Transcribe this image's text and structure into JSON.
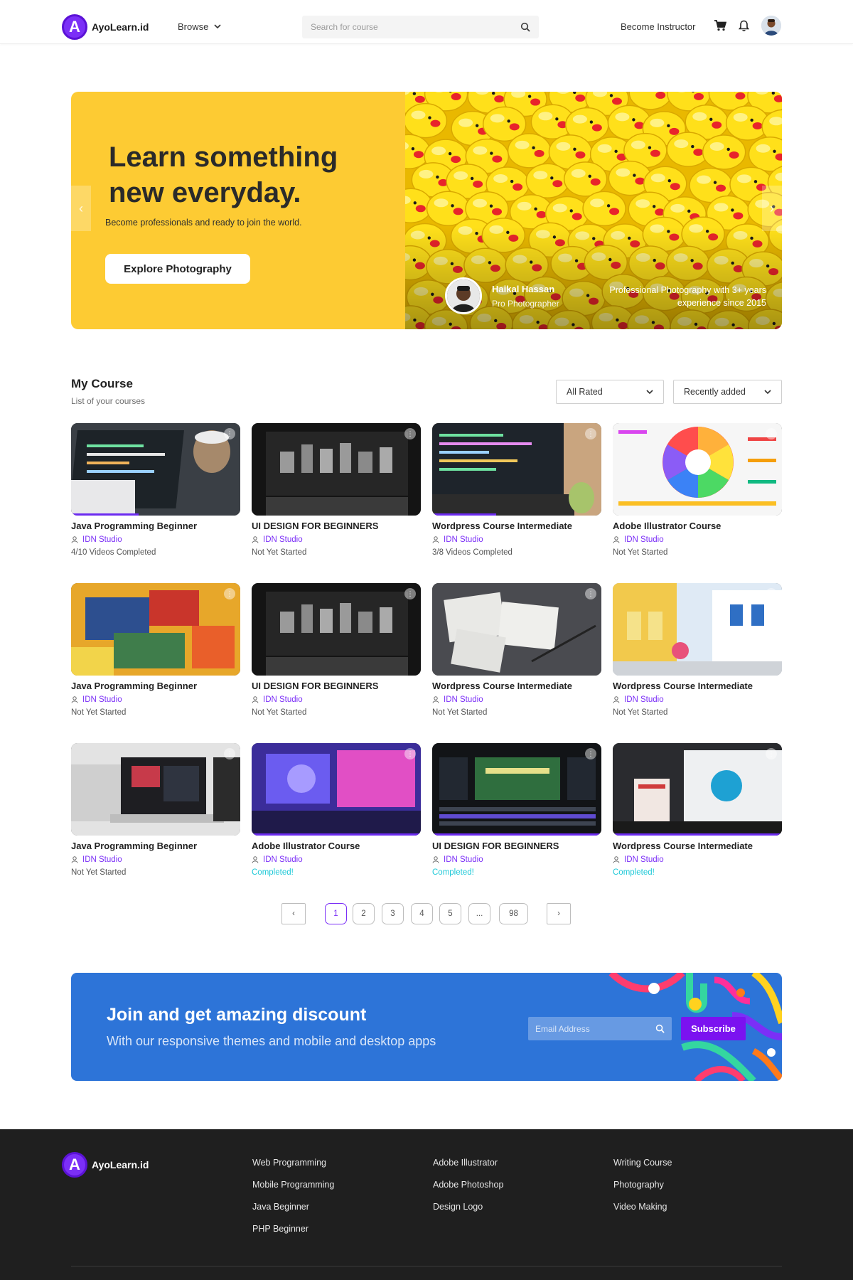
{
  "brand": {
    "name": "AyoLearn.id",
    "mark": "A",
    "color": "#7b2ff7"
  },
  "header": {
    "browse_label": "Browse",
    "search_placeholder": "Search for course",
    "become_instructor": "Become Instructor",
    "icons": [
      "cart-icon",
      "bell-icon",
      "avatar"
    ]
  },
  "hero": {
    "title": "Learn something new everyday.",
    "subtitle": "Become professionals and ready to join the world.",
    "button_label": "Explore Photography",
    "photographer_name": "Haikal Hassan",
    "photographer_role": "Pro Photographer",
    "photo_description": "Professional Photography with 3+ years experience since 2015",
    "background": "#fdcb33"
  },
  "my_course": {
    "title": "My Course",
    "subtitle": "List of your courses",
    "filter_rating": "All Rated",
    "filter_sort": "Recently added",
    "courses": [
      {
        "title": "Java Programming Beginner",
        "org": "IDN Studio",
        "status": "4/10 Videos Completed",
        "progress": 0.4,
        "thumb": "laptop-coffee"
      },
      {
        "title": "UI DESIGN FOR BEGINNERS",
        "org": "IDN Studio",
        "status": "Not Yet Started",
        "progress": 0,
        "thumb": "dark-monitor"
      },
      {
        "title": "Wordpress Course Intermediate",
        "org": "IDN Studio",
        "status": "3/8 Videos Completed",
        "progress": 0.375,
        "thumb": "laptop-code"
      },
      {
        "title": "Adobe Illustrator Course",
        "org": "IDN Studio",
        "status": "Not Yet Started",
        "progress": 0,
        "thumb": "color-wheel"
      },
      {
        "title": "Java Programming Beginner",
        "org": "IDN Studio",
        "status": "Not Yet Started",
        "progress": 0,
        "thumb": "abstract-paint"
      },
      {
        "title": "UI DESIGN FOR BEGINNERS",
        "org": "IDN Studio",
        "status": "Not Yet Started",
        "progress": 0,
        "thumb": "dark-monitor"
      },
      {
        "title": "Wordpress Course Intermediate",
        "org": "IDN Studio",
        "status": "Not Yet Started",
        "progress": 0,
        "thumb": "sketch-papers"
      },
      {
        "title": "Wordpress Course Intermediate",
        "org": "IDN Studio",
        "status": "Not Yet Started",
        "progress": 0,
        "thumb": "street-town"
      },
      {
        "title": "Java Programming Beginner",
        "org": "IDN Studio",
        "status": "Not Yet Started",
        "progress": 0,
        "thumb": "laptop-books"
      },
      {
        "title": "Adobe Illustrator Course",
        "org": "IDN Studio",
        "status": "Completed!",
        "progress": 1,
        "thumb": "purple-illustration"
      },
      {
        "title": "UI DESIGN FOR BEGINNERS",
        "org": "IDN Studio",
        "status": "Completed!",
        "progress": 1,
        "thumb": "video-editor"
      },
      {
        "title": "Wordpress Course Intermediate",
        "org": "IDN Studio",
        "status": "Completed!",
        "progress": 1,
        "thumb": "design-desk"
      }
    ]
  },
  "pagination": {
    "pages": [
      "1",
      "2",
      "3",
      "4",
      "5",
      "...",
      "98"
    ],
    "current": "1",
    "prev": "‹",
    "next": "›"
  },
  "newsletter": {
    "title": "Join and get amazing discount",
    "subtitle": "With our responsive themes and mobile and desktop apps",
    "email_placeholder": "Email Address",
    "button_label": "Subscribe"
  },
  "footer": {
    "columns": [
      [
        "Web Programming",
        "Mobile Programming",
        "Java Beginner",
        "PHP Beginner"
      ],
      [
        "Adobe Illustrator",
        "Adobe Photoshop",
        "Design Logo"
      ],
      [
        "Writing Course",
        "Photography",
        "Video Making"
      ]
    ]
  }
}
